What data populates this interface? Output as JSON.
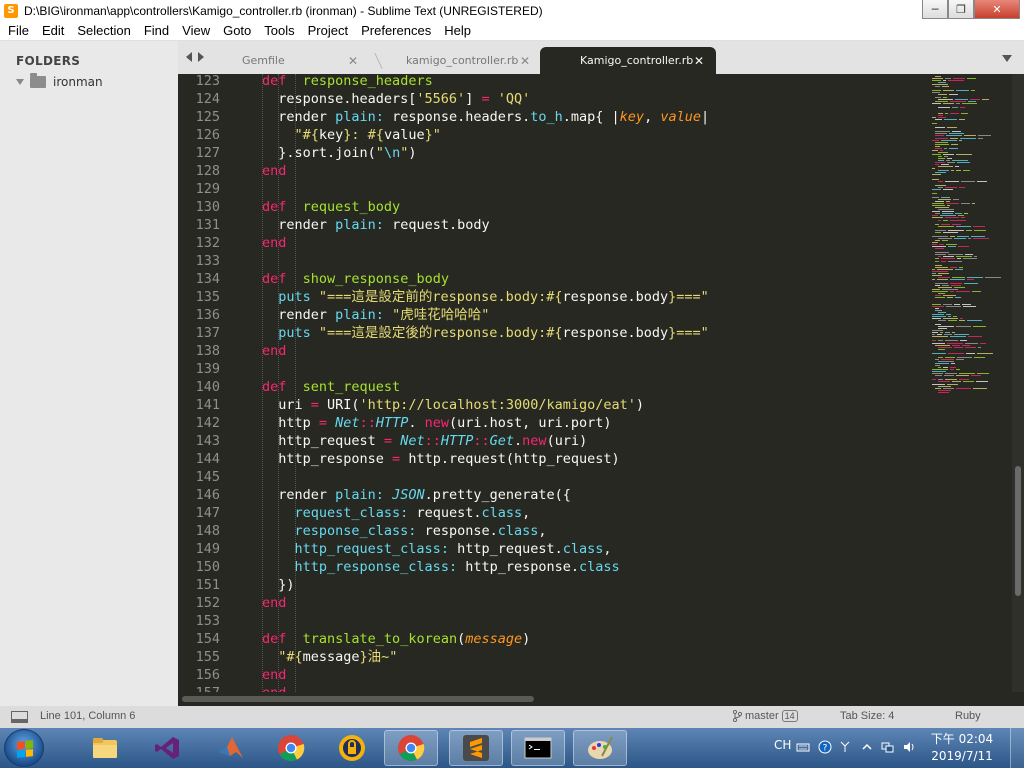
{
  "window": {
    "title": "D:\\BIG\\ironman\\app\\controllers\\Kamigo_controller.rb (ironman) - Sublime Text (UNREGISTERED)",
    "minimize": "─",
    "maximize": "❐",
    "close": "✕"
  },
  "menu": [
    "File",
    "Edit",
    "Selection",
    "Find",
    "View",
    "Goto",
    "Tools",
    "Project",
    "Preferences",
    "Help"
  ],
  "sidebar": {
    "heading": "FOLDERS",
    "folders": [
      {
        "name": "ironman"
      }
    ]
  },
  "tabs": [
    {
      "label": "Gemfile",
      "close": "✕",
      "active": false
    },
    {
      "label": "kamigo_controller.rb",
      "close": "✕",
      "active": false
    },
    {
      "label": "Kamigo_controller.rb",
      "close": "✕",
      "active": true
    }
  ],
  "editor": {
    "lines": [
      {
        "n": "123",
        "tokens": [
          [
            "kw",
            "def"
          ],
          [
            "",
            "  "
          ],
          [
            "fn",
            "response_headers"
          ]
        ],
        "indent": 2
      },
      {
        "n": "124",
        "tokens": [
          [
            "",
            "response.headers["
          ],
          [
            "str",
            "'5566'"
          ],
          [
            "",
            "] "
          ],
          [
            "op",
            "="
          ],
          [
            "",
            ""
          ],
          [
            "str",
            " 'QQ'"
          ]
        ],
        "indent": 3
      },
      {
        "n": "125",
        "tokens": [
          [
            "",
            "render "
          ],
          [
            "sym",
            "plain:"
          ],
          [
            "",
            ""
          ],
          [
            "",
            ""
          ],
          [
            "",
            ""
          ],
          [
            "",
            " response.headers."
          ],
          [
            "sym",
            "to_h"
          ],
          [
            "",
            ".map{ |"
          ],
          [
            "par",
            "key"
          ],
          [
            "",
            ", "
          ],
          [
            "par",
            "value"
          ],
          [
            "",
            "|"
          ]
        ],
        "indent": 3
      },
      {
        "n": "126",
        "tokens": [
          [
            "str",
            "\"#{"
          ],
          [
            "",
            "key"
          ],
          [
            "str",
            "}: #{"
          ],
          [
            "",
            "value"
          ],
          [
            "str",
            "}\""
          ]
        ],
        "indent": 4
      },
      {
        "n": "127",
        "tokens": [
          [
            "",
            "}.sort.join("
          ],
          [
            "str",
            "\""
          ],
          [
            "sym",
            "\\n"
          ],
          [
            "str",
            "\""
          ],
          [
            "",
            ")"
          ]
        ],
        "indent": 3
      },
      {
        "n": "128",
        "tokens": [
          [
            "kw",
            "end"
          ]
        ],
        "indent": 2
      },
      {
        "n": "129",
        "tokens": [],
        "indent": 0
      },
      {
        "n": "130",
        "tokens": [
          [
            "kw",
            "def"
          ],
          [
            "",
            "  "
          ],
          [
            "fn",
            "request_body"
          ]
        ],
        "indent": 2
      },
      {
        "n": "131",
        "tokens": [
          [
            "",
            "render "
          ],
          [
            "sym",
            "plain:"
          ],
          [
            "",
            " request.body"
          ]
        ],
        "indent": 3
      },
      {
        "n": "132",
        "tokens": [
          [
            "kw",
            "end"
          ]
        ],
        "indent": 2
      },
      {
        "n": "133",
        "tokens": [],
        "indent": 0
      },
      {
        "n": "134",
        "tokens": [
          [
            "kw",
            "def"
          ],
          [
            "",
            "  "
          ],
          [
            "fn",
            "show_response_body"
          ]
        ],
        "indent": 2
      },
      {
        "n": "135",
        "tokens": [
          [
            "sym",
            "puts"
          ],
          [
            "",
            " "
          ],
          [
            "str",
            "\"===這是設定前的response.body:#{"
          ],
          [
            "",
            "response.body"
          ],
          [
            "str",
            "}===\""
          ]
        ],
        "indent": 3
      },
      {
        "n": "136",
        "tokens": [
          [
            "",
            "render "
          ],
          [
            "sym",
            "plain:"
          ],
          [
            "",
            " "
          ],
          [
            "str",
            "\"虎哇花哈哈哈\""
          ]
        ],
        "indent": 3
      },
      {
        "n": "137",
        "tokens": [
          [
            "sym",
            "puts"
          ],
          [
            "",
            " "
          ],
          [
            "str",
            "\"===這是設定後的response.body:#{"
          ],
          [
            "",
            "response.body"
          ],
          [
            "str",
            "}===\""
          ]
        ],
        "indent": 3
      },
      {
        "n": "138",
        "tokens": [
          [
            "kw",
            "end"
          ]
        ],
        "indent": 2
      },
      {
        "n": "139",
        "tokens": [],
        "indent": 0
      },
      {
        "n": "140",
        "tokens": [
          [
            "kw",
            "def"
          ],
          [
            "",
            "  "
          ],
          [
            "fn",
            "sent_request"
          ]
        ],
        "indent": 2
      },
      {
        "n": "141",
        "tokens": [
          [
            "",
            "uri "
          ],
          [
            "op",
            "="
          ],
          [
            "",
            " URI("
          ],
          [
            "str",
            "'http://localhost:3000/kamigo/eat'"
          ],
          [
            "",
            ")"
          ]
        ],
        "indent": 3
      },
      {
        "n": "142",
        "tokens": [
          [
            "",
            "http "
          ],
          [
            "op",
            "="
          ],
          [
            "",
            " "
          ],
          [
            "cls",
            "Net"
          ],
          [
            "op",
            "::"
          ],
          [
            "cls",
            "HTTP"
          ],
          [
            "",
            ". "
          ],
          [
            "kw",
            "new"
          ],
          [
            "",
            "(uri.host, uri.port)"
          ]
        ],
        "indent": 3
      },
      {
        "n": "143",
        "tokens": [
          [
            "",
            "http_request "
          ],
          [
            "op",
            "="
          ],
          [
            "",
            " "
          ],
          [
            "cls",
            "Net"
          ],
          [
            "op",
            "::"
          ],
          [
            "cls",
            "HTTP"
          ],
          [
            "op",
            "::"
          ],
          [
            "cls",
            "Get"
          ],
          [
            "",
            "."
          ],
          [
            "kw",
            "new"
          ],
          [
            "",
            "(uri)"
          ]
        ],
        "indent": 3
      },
      {
        "n": "144",
        "tokens": [
          [
            "",
            "http_response "
          ],
          [
            "op",
            "="
          ],
          [
            "",
            " http.request(http_request)"
          ]
        ],
        "indent": 3
      },
      {
        "n": "145",
        "tokens": [],
        "indent": 0
      },
      {
        "n": "146",
        "tokens": [
          [
            "",
            "render "
          ],
          [
            "sym",
            "plain:"
          ],
          [
            "",
            " "
          ],
          [
            "cls",
            "JSON"
          ],
          [
            "",
            ".pretty_generate({"
          ]
        ],
        "indent": 3
      },
      {
        "n": "147",
        "tokens": [
          [
            "sym",
            "request_class:"
          ],
          [
            "",
            " request."
          ],
          [
            "sym",
            "class"
          ],
          [
            "",
            ","
          ]
        ],
        "indent": 4
      },
      {
        "n": "148",
        "tokens": [
          [
            "sym",
            "response_class:"
          ],
          [
            "",
            " response."
          ],
          [
            "sym",
            "class"
          ],
          [
            "",
            ","
          ]
        ],
        "indent": 4
      },
      {
        "n": "149",
        "tokens": [
          [
            "sym",
            "http_request_class:"
          ],
          [
            "",
            " http_request."
          ],
          [
            "sym",
            "class"
          ],
          [
            "",
            ","
          ]
        ],
        "indent": 4
      },
      {
        "n": "150",
        "tokens": [
          [
            "sym",
            "http_response_class:"
          ],
          [
            "",
            " http_response."
          ],
          [
            "sym",
            "class"
          ]
        ],
        "indent": 4
      },
      {
        "n": "151",
        "tokens": [
          [
            "",
            "})"
          ]
        ],
        "indent": 3
      },
      {
        "n": "152",
        "tokens": [
          [
            "kw",
            "end"
          ]
        ],
        "indent": 2
      },
      {
        "n": "153",
        "tokens": [],
        "indent": 0
      },
      {
        "n": "154",
        "tokens": [
          [
            "kw",
            "def"
          ],
          [
            "",
            "  "
          ],
          [
            "fn",
            "translate_to_korean"
          ],
          [
            "",
            "("
          ],
          [
            "par",
            "message"
          ],
          [
            "",
            ")"
          ]
        ],
        "indent": 2
      },
      {
        "n": "155",
        "tokens": [
          [
            "str",
            "\"#{"
          ],
          [
            "",
            "message"
          ],
          [
            "str",
            "}油~\""
          ]
        ],
        "indent": 3
      },
      {
        "n": "156",
        "tokens": [
          [
            "kw",
            "end"
          ]
        ],
        "indent": 2
      },
      {
        "n": "157",
        "tokens": [
          [
            "kw",
            "end"
          ]
        ],
        "indent": 1
      }
    ]
  },
  "status": {
    "position": "Line 101, Column 6",
    "branch": "master",
    "changes": "14",
    "tab_size": "Tab Size: 4",
    "syntax": "Ruby"
  },
  "taskbar": {
    "apps": [
      "file-explorer",
      "visual-studio",
      "matlab",
      "chrome",
      "keepass",
      "chrome",
      "sublime-text",
      "command-prompt",
      "paint"
    ],
    "ime": "CH",
    "time": "下午 02:04",
    "date": "2019/7/11"
  },
  "colors": {
    "editor_bg": "#272822",
    "keyword": "#f92672",
    "function": "#a6e22e",
    "string": "#e6db74",
    "symbol": "#66d9ef",
    "parameter": "#fd971f"
  }
}
